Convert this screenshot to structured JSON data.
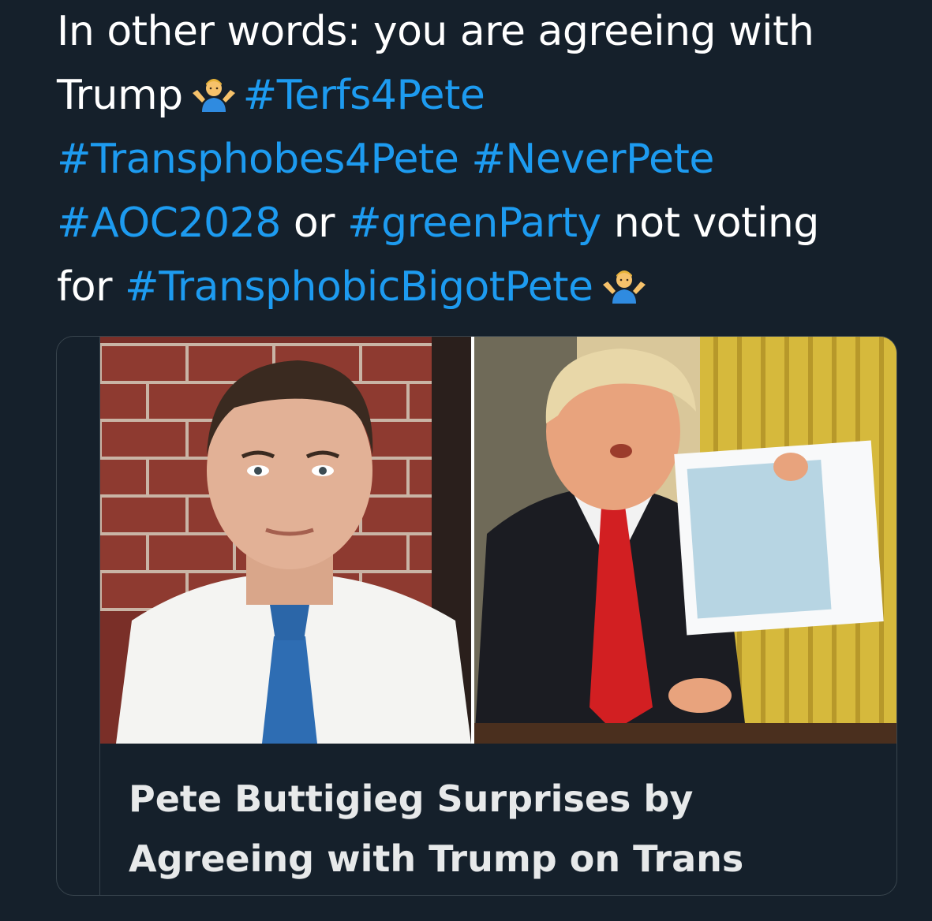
{
  "tweet": {
    "line1": "In other words: you are agreeing with",
    "line2_text": "Trump",
    "line2_tag": "#Terfs4Pete",
    "line3_tag1": "#Transphobes4Pete",
    "line3_tag2": "#NeverPete",
    "line4_tag1": "#AOC2028",
    "line4_or": "or",
    "line4_tag2": "#greenParty",
    "line4_text": "not voting",
    "line5_text": "for",
    "line5_tag": "#TransphobicBigotPete",
    "emoji_1": "person-shrugging-icon",
    "emoji_2": "person-shrugging-icon"
  },
  "card": {
    "title_line1": "Pete Buttigieg Surprises by",
    "title_line2": "Agreeing with Trump on Trans",
    "image_left": "photo of Pete Buttigieg in front of brick wall",
    "image_right": "photo of Donald Trump holding a hurricane map"
  },
  "colors": {
    "background": "#15202b",
    "text": "#ffffff",
    "hashtag": "#1d9bf0",
    "card_border": "#38444d"
  }
}
